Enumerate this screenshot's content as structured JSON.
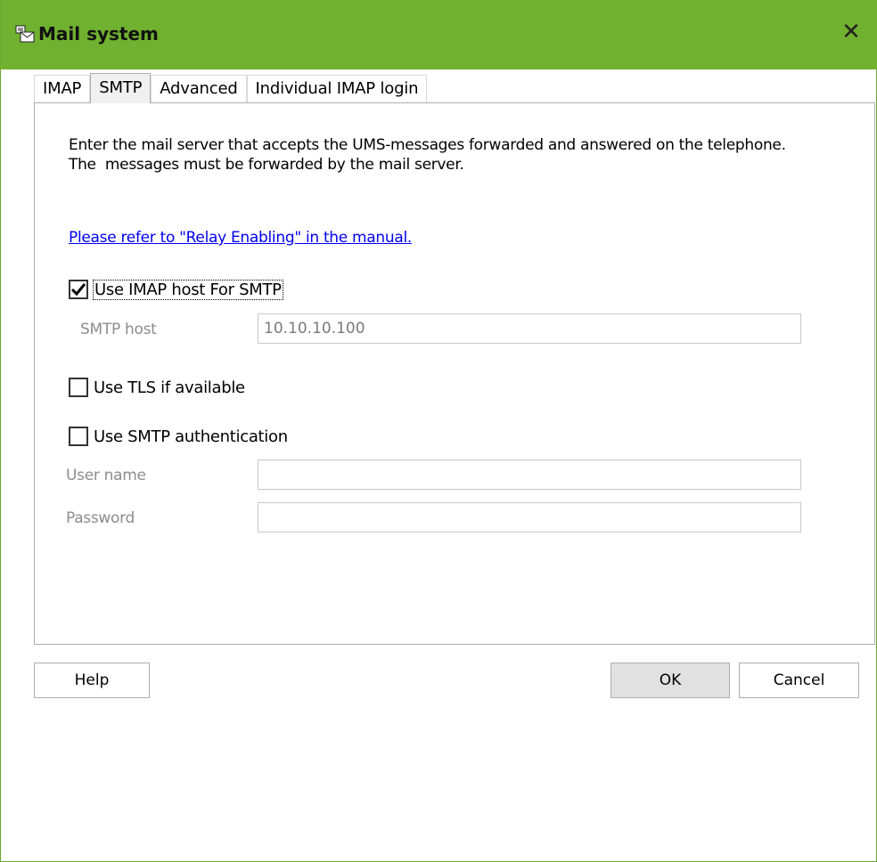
{
  "window": {
    "title": "Mail system",
    "close_glyph": "✕",
    "accent_color": "#70b130"
  },
  "tabs": [
    {
      "label": "IMAP",
      "active": false
    },
    {
      "label": "SMTP",
      "active": true
    },
    {
      "label": "Advanced",
      "active": false
    },
    {
      "label": "Individual IMAP login",
      "active": false
    }
  ],
  "smtp": {
    "description_line1": "Enter the mail server that accepts the UMS-messages forwarded and answered on the telephone.",
    "description_line2": "The  messages must be forwarded by the mail server.",
    "relay_link": "Please refer to \"Relay Enabling\" in the manual.",
    "use_imap_host": {
      "label": "Use IMAP host For SMTP",
      "checked": true
    },
    "smtp_host": {
      "label": "SMTP host",
      "value": "10.10.10.100"
    },
    "use_tls": {
      "label": "Use TLS if available",
      "checked": false
    },
    "use_auth": {
      "label": "Use SMTP authentication",
      "checked": false
    },
    "user_name": {
      "label": "User name",
      "value": ""
    },
    "password": {
      "label": "Password",
      "value": ""
    }
  },
  "buttons": {
    "help": "Help",
    "ok": "OK",
    "cancel": "Cancel"
  },
  "icons": {
    "app": "mail-system-icon",
    "close": "close-icon",
    "check": "checkmark-icon"
  }
}
